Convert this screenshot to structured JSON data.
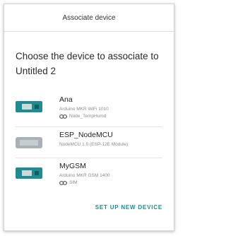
{
  "dialog": {
    "title": "Associate device",
    "heading": "Choose the device to associate to Untitled 2"
  },
  "devices": [
    {
      "name": "Ana",
      "board": "Arduino MKR WiFi 1010",
      "thing": "Node_TempHumd",
      "icon": "mkr-board-icon"
    },
    {
      "name": "ESP_NodeMCU",
      "board": "NodeMCU 1.0 (ESP-12E Module)",
      "thing": "",
      "icon": "nodemcu-board-icon"
    },
    {
      "name": "MyGSM",
      "board": "Arduino MKR GSM 1400",
      "thing": "SIM",
      "icon": "mkr-board-icon"
    }
  ],
  "actions": {
    "setup_label": "SET UP NEW DEVICE"
  },
  "colors": {
    "accent": "#1d8a91",
    "board_teal": "#1e8c91",
    "board_grey": "#a9b1b6"
  }
}
